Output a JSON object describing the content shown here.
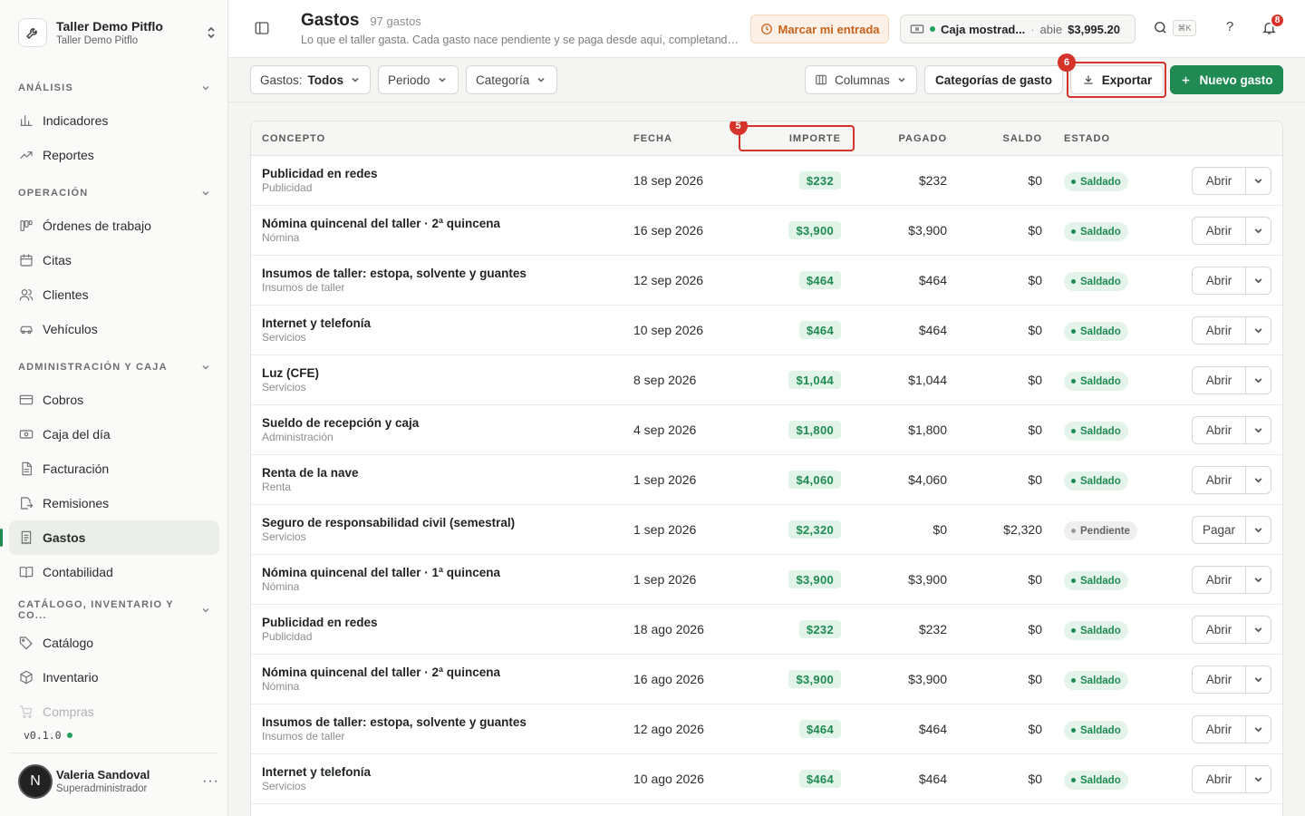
{
  "org": {
    "name": "Taller Demo Pitflo",
    "subtitle": "Taller Demo Pitflo"
  },
  "sidebar": {
    "sections": [
      {
        "title": "ANÁLISIS",
        "items": [
          {
            "label": "Indicadores",
            "icon": "bar-chart-icon"
          },
          {
            "label": "Reportes",
            "icon": "trend-icon"
          }
        ]
      },
      {
        "title": "OPERACIÓN",
        "items": [
          {
            "label": "Órdenes de trabajo",
            "icon": "kanban-icon"
          },
          {
            "label": "Citas",
            "icon": "calendar-icon"
          },
          {
            "label": "Clientes",
            "icon": "users-icon"
          },
          {
            "label": "Vehículos",
            "icon": "car-icon"
          }
        ]
      },
      {
        "title": "ADMINISTRACIÓN Y CAJA",
        "items": [
          {
            "label": "Cobros",
            "icon": "card-icon"
          },
          {
            "label": "Caja del día",
            "icon": "cash-icon"
          },
          {
            "label": "Facturación",
            "icon": "document-icon"
          },
          {
            "label": "Remisiones",
            "icon": "export-doc-icon"
          },
          {
            "label": "Gastos",
            "icon": "receipt-icon",
            "active": true
          },
          {
            "label": "Contabilidad",
            "icon": "book-icon"
          }
        ]
      },
      {
        "title": "CATÁLOGO, INVENTARIO Y CO...",
        "items": [
          {
            "label": "Catálogo",
            "icon": "tag-icon"
          },
          {
            "label": "Inventario",
            "icon": "box-icon"
          },
          {
            "label": "Compras",
            "icon": "cart-icon",
            "faded": true
          }
        ]
      }
    ],
    "version": "v0.1.0"
  },
  "user": {
    "initial": "N",
    "name": "Valeria Sandoval",
    "role": "Superadministrador",
    "more": "···"
  },
  "header": {
    "title": "Gastos",
    "count": "97 gastos",
    "description": "Lo que el taller gasta. Cada gasto nace pendiente y se paga desde aquí, completando el flujo de caja.",
    "checkin_label": "Marcar mi entrada",
    "caja": {
      "name": "Caja mostrad...",
      "sep": "·",
      "state": "abie",
      "amount": "$3,995.20"
    },
    "shortcut": "⌘K",
    "help": "?",
    "notifications": "8"
  },
  "toolbar": {
    "filter_prefix": "Gastos:",
    "filter_value": "Todos",
    "period": "Periodo",
    "category": "Categoría",
    "columns": "Columnas",
    "expense_categories": "Categorías de gasto",
    "export": "Exportar",
    "new_expense": "Nuevo gasto"
  },
  "markers": {
    "import": "5",
    "export": "6"
  },
  "table": {
    "headers": {
      "concept": "CONCEPTO",
      "date": "FECHA",
      "amount": "IMPORTE",
      "paid": "PAGADO",
      "balance": "SALDO",
      "status": "ESTADO"
    },
    "rows": [
      {
        "title": "Publicidad en redes",
        "category": "Publicidad",
        "date": "18 sep 2026",
        "amount": "$232",
        "paid": "$232",
        "balance": "$0",
        "status": "Saldado",
        "action": "Abrir"
      },
      {
        "title": "Nómina quincenal del taller · 2ª quincena",
        "category": "Nómina",
        "date": "16 sep 2026",
        "amount": "$3,900",
        "paid": "$3,900",
        "balance": "$0",
        "status": "Saldado",
        "action": "Abrir"
      },
      {
        "title": "Insumos de taller: estopa, solvente y guantes",
        "category": "Insumos de taller",
        "date": "12 sep 2026",
        "amount": "$464",
        "paid": "$464",
        "balance": "$0",
        "status": "Saldado",
        "action": "Abrir"
      },
      {
        "title": "Internet y telefonía",
        "category": "Servicios",
        "date": "10 sep 2026",
        "amount": "$464",
        "paid": "$464",
        "balance": "$0",
        "status": "Saldado",
        "action": "Abrir"
      },
      {
        "title": "Luz (CFE)",
        "category": "Servicios",
        "date": "8 sep 2026",
        "amount": "$1,044",
        "paid": "$1,044",
        "balance": "$0",
        "status": "Saldado",
        "action": "Abrir"
      },
      {
        "title": "Sueldo de recepción y caja",
        "category": "Administración",
        "date": "4 sep 2026",
        "amount": "$1,800",
        "paid": "$1,800",
        "balance": "$0",
        "status": "Saldado",
        "action": "Abrir"
      },
      {
        "title": "Renta de la nave",
        "category": "Renta",
        "date": "1 sep 2026",
        "amount": "$4,060",
        "paid": "$4,060",
        "balance": "$0",
        "status": "Saldado",
        "action": "Abrir"
      },
      {
        "title": "Seguro de responsabilidad civil (semestral)",
        "category": "Servicios",
        "date": "1 sep 2026",
        "amount": "$2,320",
        "paid": "$0",
        "balance": "$2,320",
        "status": "Pendiente",
        "action": "Pagar"
      },
      {
        "title": "Nómina quincenal del taller · 1ª quincena",
        "category": "Nómina",
        "date": "1 sep 2026",
        "amount": "$3,900",
        "paid": "$3,900",
        "balance": "$0",
        "status": "Saldado",
        "action": "Abrir"
      },
      {
        "title": "Publicidad en redes",
        "category": "Publicidad",
        "date": "18 ago 2026",
        "amount": "$232",
        "paid": "$232",
        "balance": "$0",
        "status": "Saldado",
        "action": "Abrir"
      },
      {
        "title": "Nómina quincenal del taller · 2ª quincena",
        "category": "Nómina",
        "date": "16 ago 2026",
        "amount": "$3,900",
        "paid": "$3,900",
        "balance": "$0",
        "status": "Saldado",
        "action": "Abrir"
      },
      {
        "title": "Insumos de taller: estopa, solvente y guantes",
        "category": "Insumos de taller",
        "date": "12 ago 2026",
        "amount": "$464",
        "paid": "$464",
        "balance": "$0",
        "status": "Saldado",
        "action": "Abrir"
      },
      {
        "title": "Internet y telefonía",
        "category": "Servicios",
        "date": "10 ago 2026",
        "amount": "$464",
        "paid": "$464",
        "balance": "$0",
        "status": "Saldado",
        "action": "Abrir"
      }
    ]
  },
  "colors": {
    "accent": "#1f8b53",
    "warning": "#c4611b",
    "highlight": "#d6332a"
  }
}
